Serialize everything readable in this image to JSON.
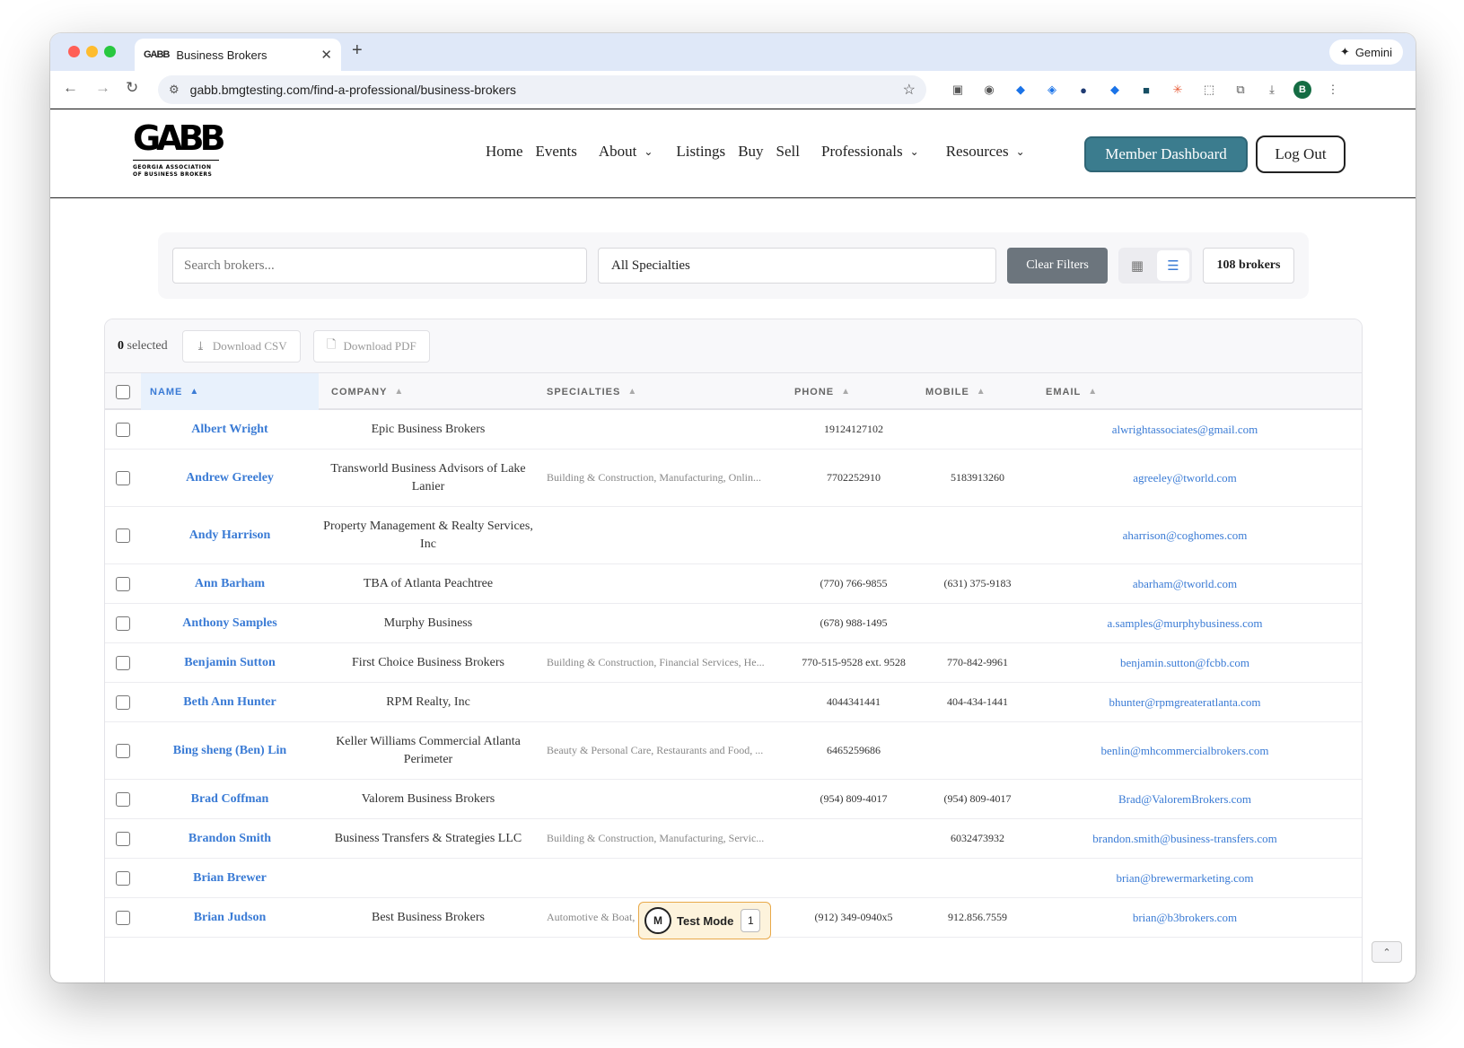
{
  "browser": {
    "tab_title": "Business Brokers",
    "tab_favicon": "GABB",
    "url": "gabb.bmgtesting.com/find-a-professional/business-brokers",
    "gemini_label": "Gemini",
    "profile_initial": "B"
  },
  "site": {
    "logo_mark": "GABB",
    "logo_sub_1": "GEORGIA ASSOCIATION",
    "logo_sub_2": "OF BUSINESS BROKERS",
    "nav": [
      "Home",
      "Events",
      "About",
      "Listings",
      "Buy",
      "Sell",
      "Professionals",
      "Resources"
    ],
    "dashboard_label": "Member Dashboard",
    "logout_label": "Log Out"
  },
  "filters": {
    "search_placeholder": "Search brokers...",
    "specialty_value": "All Specialties",
    "clear_label": "Clear Filters",
    "count_label": "108 brokers"
  },
  "toolbar": {
    "selected_count": "0",
    "selected_label": "selected",
    "csv_label": "Download CSV",
    "pdf_label": "Download PDF"
  },
  "columns": [
    "NAME",
    "COMPANY",
    "SPECIALTIES",
    "PHONE",
    "MOBILE",
    "EMAIL"
  ],
  "rows": [
    {
      "name": "Albert Wright",
      "company": "Epic Business Brokers",
      "specialties": "",
      "phone": "19124127102",
      "mobile": "",
      "email": "alwrightassociates@gmail.com"
    },
    {
      "name": "Andrew Greeley",
      "company": "Transworld Business Advisors of Lake Lanier",
      "specialties": "Building & Construction, Manufacturing, Onlin...",
      "phone": "7702252910",
      "mobile": "5183913260",
      "email": "agreeley@tworld.com"
    },
    {
      "name": "Andy Harrison",
      "company": "Property Management & Realty Services, Inc",
      "specialties": "",
      "phone": "",
      "mobile": "",
      "email": "aharrison@coghomes.com"
    },
    {
      "name": "Ann Barham",
      "company": "TBA of Atlanta Peachtree",
      "specialties": "",
      "phone": "(770) 766-9855",
      "mobile": "(631) 375-9183",
      "email": "abarham@tworld.com"
    },
    {
      "name": "Anthony Samples",
      "company": "Murphy Business",
      "specialties": "",
      "phone": "(678) 988-1495",
      "mobile": "",
      "email": "a.samples@murphybusiness.com"
    },
    {
      "name": "Benjamin Sutton",
      "company": "First Choice Business Brokers",
      "specialties": "Building & Construction, Financial Services, He...",
      "phone": "770-515-9528 ext. 9528",
      "mobile": "770-842-9961",
      "email": "benjamin.sutton@fcbb.com"
    },
    {
      "name": "Beth Ann Hunter",
      "company": "RPM Realty, Inc",
      "specialties": "",
      "phone": "4044341441",
      "mobile": "404-434-1441",
      "email": "bhunter@rpmgreateratlanta.com"
    },
    {
      "name": "Bing sheng (Ben) Lin",
      "company": "Keller Williams Commercial Atlanta Perimeter",
      "specialties": "Beauty & Personal Care, Restaurants and Food, ...",
      "phone": "6465259686",
      "mobile": "",
      "email": "benlin@mhcommercialbrokers.com"
    },
    {
      "name": "Brad Coffman",
      "company": "Valorem Business Brokers",
      "specialties": "",
      "phone": "(954) 809-4017",
      "mobile": "(954) 809-4017",
      "email": "Brad@ValoremBrokers.com"
    },
    {
      "name": "Brandon Smith",
      "company": "Business Transfers & Strategies LLC",
      "specialties": "Building & Construction, Manufacturing, Servic...",
      "phone": "",
      "mobile": "6032473932",
      "email": "brandon.smith@business-transfers.com"
    },
    {
      "name": "Brian Brewer",
      "company": "",
      "specialties": "",
      "phone": "",
      "mobile": "",
      "email": "brian@brewermarketing.com"
    },
    {
      "name": "Brian Judson",
      "company": "Best Business Brokers",
      "specialties": "Automotive & Boat, ...",
      "phone": "(912) 349-0940x5",
      "mobile": "912.856.7559",
      "email": "brian@b3brokers.com"
    }
  ],
  "test_mode": {
    "label": "Test Mode",
    "count": "1"
  }
}
